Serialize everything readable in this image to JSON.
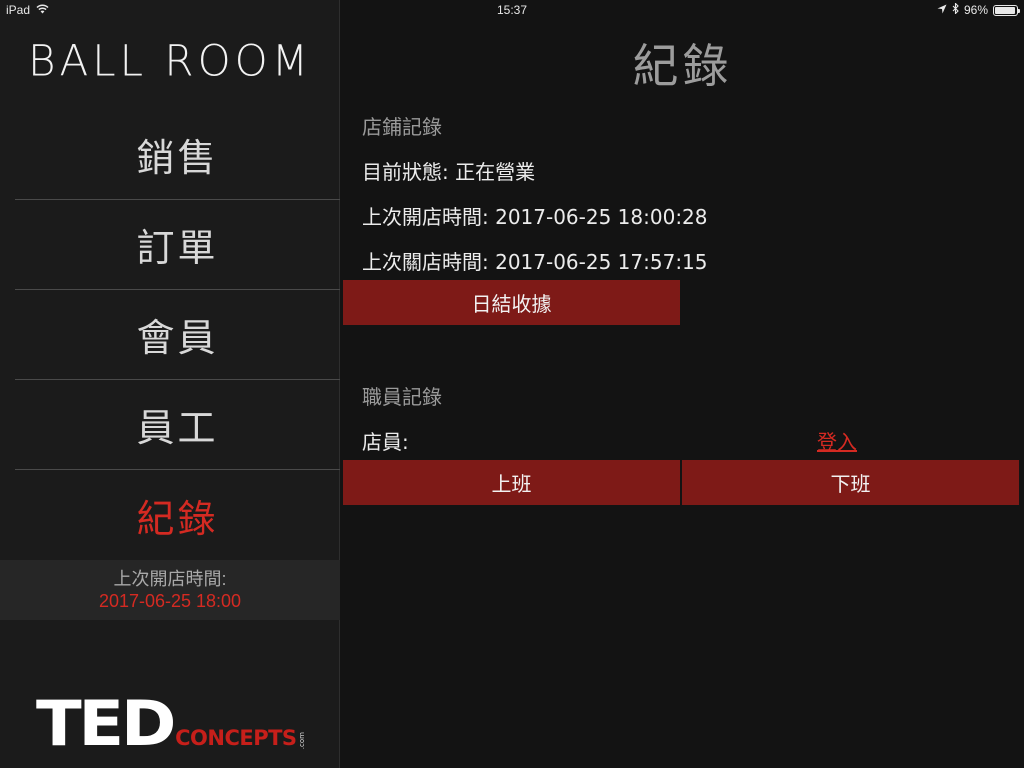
{
  "status_bar": {
    "device": "iPad",
    "time": "15:37",
    "battery": "96%",
    "battery_level": 0.96
  },
  "sidebar": {
    "brand": "BALL ROOM",
    "nav": [
      {
        "label": "銷售",
        "active": false
      },
      {
        "label": "訂單",
        "active": false
      },
      {
        "label": "會員",
        "active": false
      },
      {
        "label": "員工",
        "active": false
      },
      {
        "label": "紀錄",
        "active": true
      }
    ],
    "last_open_label": "上次開店時間:",
    "last_open_value": "2017-06-25 18:00",
    "logo_main": "TED",
    "logo_sub": "CONCEPTS",
    "logo_suffix": ".com"
  },
  "main": {
    "title": "紀錄",
    "store": {
      "heading": "店鋪記錄",
      "status": "目前狀態: 正在營業",
      "last_open": "上次開店時間: 2017-06-25 18:00:28",
      "last_close": "上次關店時間: 2017-06-25 17:57:15",
      "daily_button": "日結收據"
    },
    "staff": {
      "heading": "職員記錄",
      "staff_label": "店員:",
      "login_link": "登入",
      "clock_in": "上班",
      "clock_out": "下班"
    }
  },
  "colors": {
    "accent_red": "#d42a22",
    "button_red": "#7e1a17",
    "sidebar_bg": "#1b1b1b",
    "main_bg": "#131313"
  }
}
